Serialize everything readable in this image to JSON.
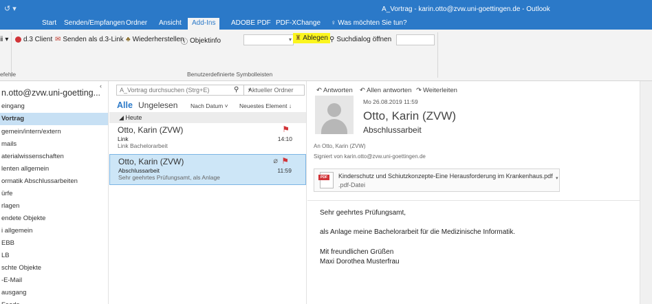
{
  "window": {
    "qat_glyph": "↺ ▾",
    "title": "A_Vortrag - karin.otto@zvw.uni-goettingen.de - Outlook"
  },
  "ribbon_tabs": [
    "Start",
    "Senden/Empfangen",
    "Ordner",
    "Ansicht",
    "Add-Ins",
    "ADOBE PDF",
    "PDF-XChange"
  ],
  "tell_me": "Was möchten Sie tun?",
  "ribbon": {
    "left_stub": "ⅱ ▾",
    "d3_client": "d.3 Client",
    "send_d3_link": "Senden als d.3-Link",
    "restore": "Wiederherstellen",
    "objectinfo": "Objektinfo",
    "ablegen": "Ablegen",
    "search_dialog": "Suchdialog öffnen",
    "group_label": "Benutzerdefinierte Symbolleisten",
    "group_label_left": "efehle"
  },
  "folders": {
    "account": "n.otto@zvw.uni-goetting...",
    "items": [
      {
        "label": "eingang",
        "selected": false
      },
      {
        "label": "Vortrag",
        "selected": true
      },
      {
        "label": "gemein/intern/extern",
        "selected": false
      },
      {
        "label": "mails",
        "selected": false
      },
      {
        "label": "aterialwissenschaften",
        "selected": false
      },
      {
        "label": "lenten allgemein",
        "selected": false
      },
      {
        "label": "ormatik Abschlussarbeiten",
        "selected": false
      },
      {
        "label": "ürfe",
        "selected": false
      },
      {
        "label": "rlagen",
        "selected": false
      },
      {
        "label": "endete Objekte",
        "selected": false
      },
      {
        "label": "i allgemein",
        "selected": false
      },
      {
        "label": "EBB",
        "selected": false
      },
      {
        "label": "LB",
        "selected": false
      },
      {
        "label": "schte Objekte",
        "selected": false
      },
      {
        "label": "-E-Mail",
        "selected": false
      },
      {
        "label": "ausgang",
        "selected": false
      },
      {
        "label": "Feeds",
        "selected": false
      }
    ]
  },
  "list": {
    "search_placeholder": "A_Vortrag durchsuchen (Strg+E)",
    "scope": "Aktueller Ordner",
    "filter_all": "Alle",
    "filter_unread": "Ungelesen",
    "sort_by": "Nach Datum ˅",
    "sort_order": "Neuestes Element ↓",
    "group": "◢ Heute",
    "messages": [
      {
        "from": "Otto, Karin (ZVW)",
        "subject": "Link",
        "preview": "Link Bachelorarbeit",
        "time": "14:10",
        "flag": "⚑",
        "attachment": false,
        "selected": false
      },
      {
        "from": "Otto, Karin (ZVW)",
        "subject": "Abschlussarbeit",
        "preview": "Sehr geehrtes Prüfungsamt,  als Anlage",
        "time": "11:59",
        "flag": "⚑",
        "attachment": true,
        "selected": true
      }
    ]
  },
  "reading": {
    "reply": "Antworten",
    "reply_all": "Allen antworten",
    "forward": "Weiterleiten",
    "date": "Mo 26.08.2019 11:59",
    "from": "Otto, Karin (ZVW)",
    "subject": "Abschlussarbeit",
    "to": "An   Otto, Karin (ZVW)",
    "signed": "Signiert von   karin.otto@zvw.uni-goettingen.de",
    "attachment_name": "Kinderschutz und Schiutzkonzepte-Eine Herausforderung im Krankenhaus.pdf",
    "attachment_type": ".pdf-Datei",
    "pdf_badge": "PDF",
    "body": [
      "Sehr geehrtes Prüfungsamt,",
      "als Anlage meine Bachelorarbeit für die Medizinische Informatik.",
      "Mit freundlichen Grüßen",
      "Maxi Dorothea Musterfrau"
    ]
  },
  "colors": {
    "accent": "#2b79c8",
    "highlight": "#fbf51e",
    "selected_row": "#cde6f7",
    "flag": "#d13438"
  }
}
